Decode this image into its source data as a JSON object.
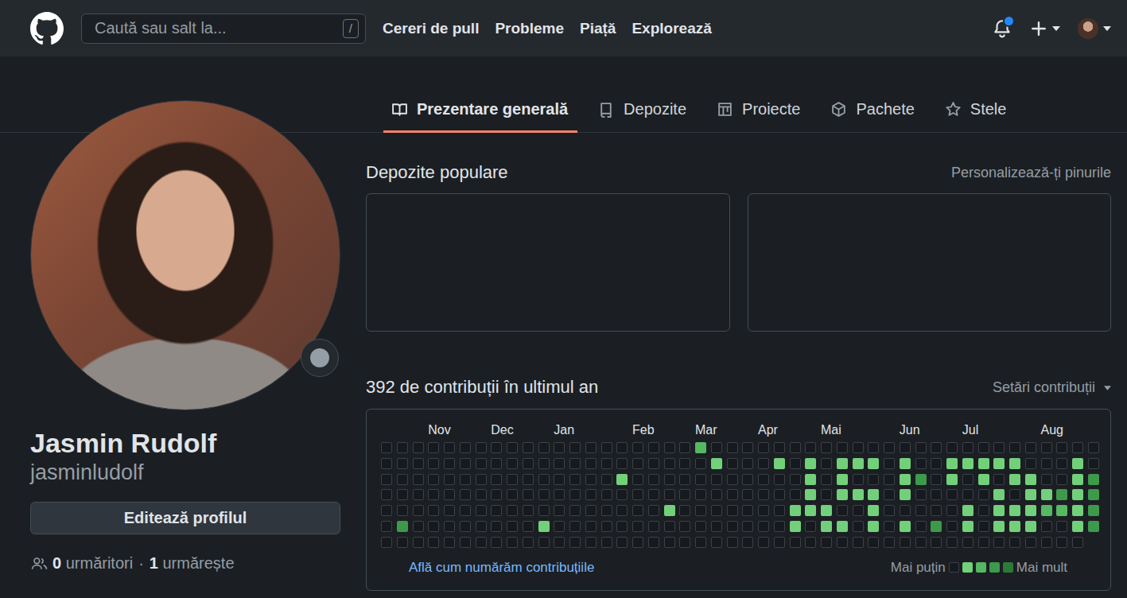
{
  "header": {
    "search": {
      "placeholder": "Caută sau salt la...",
      "shortcut": "/"
    },
    "nav": [
      "Cereri de pull",
      "Probleme",
      "Piață",
      "Explorează"
    ],
    "notifications": {
      "unread": true
    }
  },
  "tabs": [
    {
      "label": "Prezentare generală",
      "icon": "book",
      "selected": true
    },
    {
      "label": "Depozite",
      "icon": "repo",
      "selected": false
    },
    {
      "label": "Proiecte",
      "icon": "project",
      "selected": false
    },
    {
      "label": "Pachete",
      "icon": "package",
      "selected": false
    },
    {
      "label": "Stele",
      "icon": "star",
      "selected": false
    }
  ],
  "profile": {
    "name": "Jasmin Rudolf",
    "username": "jasminludolf",
    "edit_button": "Editează profilul",
    "followers": {
      "count": "0",
      "label": "urmăritori"
    },
    "separator": "·",
    "following": {
      "count": "1",
      "label": "urmărește"
    }
  },
  "pinned": {
    "title": "Depozite populare",
    "customize": "Personalizează-ți pinurile",
    "cards": [
      {
        "empty": true
      },
      {
        "empty": true
      }
    ]
  },
  "contributions": {
    "title": "392 de contribuții în ultimul an",
    "settings": "Setări contribuții",
    "months": [
      {
        "label": "Nov",
        "week": 3
      },
      {
        "label": "Dec",
        "week": 7
      },
      {
        "label": "Jan",
        "week": 11
      },
      {
        "label": "Feb",
        "week": 16
      },
      {
        "label": "Mar",
        "week": 20
      },
      {
        "label": "Apr",
        "week": 24
      },
      {
        "label": "Mai",
        "week": 28
      },
      {
        "label": "Jun",
        "week": 33
      },
      {
        "label": "Jul",
        "week": 37
      },
      {
        "label": "Aug",
        "week": 42
      }
    ],
    "weeks": [
      [
        0,
        0,
        0,
        0,
        0,
        0,
        0
      ],
      [
        0,
        0,
        0,
        0,
        0,
        3,
        0
      ],
      [
        0,
        0,
        0,
        0,
        0,
        0,
        0
      ],
      [
        0,
        0,
        0,
        0,
        0,
        0,
        0
      ],
      [
        0,
        0,
        0,
        0,
        0,
        0,
        0
      ],
      [
        0,
        0,
        0,
        0,
        0,
        0,
        0
      ],
      [
        0,
        0,
        0,
        0,
        0,
        0,
        0
      ],
      [
        0,
        0,
        0,
        0,
        0,
        0,
        0
      ],
      [
        0,
        0,
        0,
        0,
        0,
        0,
        0
      ],
      [
        0,
        0,
        0,
        0,
        0,
        0,
        0
      ],
      [
        0,
        0,
        0,
        0,
        0,
        1,
        0
      ],
      [
        0,
        0,
        0,
        0,
        0,
        0,
        0
      ],
      [
        0,
        0,
        0,
        0,
        0,
        0,
        0
      ],
      [
        0,
        0,
        0,
        0,
        0,
        0,
        0
      ],
      [
        0,
        0,
        0,
        0,
        0,
        0,
        0
      ],
      [
        0,
        0,
        1,
        0,
        0,
        0,
        0
      ],
      [
        0,
        0,
        0,
        0,
        0,
        0,
        0
      ],
      [
        0,
        0,
        0,
        0,
        0,
        0,
        0
      ],
      [
        0,
        0,
        0,
        0,
        1,
        0,
        0
      ],
      [
        0,
        0,
        0,
        0,
        0,
        0,
        0
      ],
      [
        2,
        0,
        0,
        0,
        0,
        0,
        0
      ],
      [
        0,
        1,
        0,
        0,
        0,
        0,
        0
      ],
      [
        0,
        0,
        0,
        0,
        0,
        0,
        0
      ],
      [
        0,
        0,
        0,
        0,
        0,
        0,
        0
      ],
      [
        0,
        0,
        0,
        0,
        0,
        0,
        0
      ],
      [
        0,
        1,
        0,
        0,
        0,
        0,
        0
      ],
      [
        0,
        0,
        0,
        0,
        1,
        1,
        0
      ],
      [
        0,
        1,
        1,
        1,
        1,
        0,
        0
      ],
      [
        0,
        0,
        0,
        0,
        1,
        1,
        0
      ],
      [
        0,
        1,
        1,
        1,
        0,
        1,
        0
      ],
      [
        0,
        1,
        0,
        1,
        0,
        0,
        0
      ],
      [
        0,
        1,
        0,
        1,
        1,
        1,
        0
      ],
      [
        0,
        0,
        0,
        0,
        0,
        0,
        0
      ],
      [
        0,
        1,
        1,
        1,
        0,
        1,
        0
      ],
      [
        0,
        0,
        3,
        0,
        0,
        0,
        0
      ],
      [
        0,
        0,
        0,
        0,
        0,
        3,
        0
      ],
      [
        0,
        1,
        1,
        0,
        0,
        0,
        0
      ],
      [
        0,
        1,
        0,
        0,
        1,
        1,
        0
      ],
      [
        0,
        1,
        1,
        0,
        0,
        0,
        0
      ],
      [
        0,
        1,
        0,
        1,
        1,
        1,
        0
      ],
      [
        0,
        1,
        1,
        0,
        1,
        1,
        0
      ],
      [
        0,
        0,
        1,
        1,
        1,
        1,
        0
      ],
      [
        0,
        0,
        0,
        1,
        2,
        0,
        0
      ],
      [
        0,
        0,
        0,
        3,
        2,
        0,
        0
      ],
      [
        0,
        1,
        1,
        1,
        1,
        1,
        0
      ],
      [
        0,
        0,
        3,
        3,
        3,
        3
      ]
    ],
    "learn_more": "Află cum numărăm contribuțiile",
    "legend": {
      "less": "Mai puțin",
      "more": "Mai mult",
      "levels": [
        0,
        1,
        2,
        3,
        4
      ]
    }
  }
}
